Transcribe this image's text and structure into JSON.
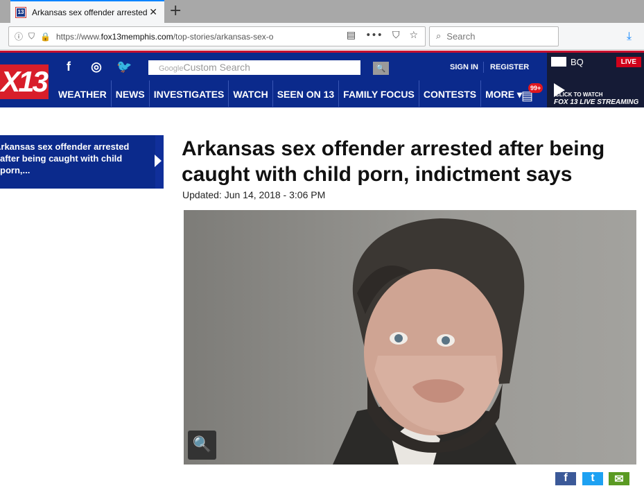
{
  "browser": {
    "tab_title": "Arkansas sex offender arrested a",
    "tab_favicon_text": "13",
    "tab_close": "✕",
    "new_tab": "+",
    "url_prefix": "https://www.",
    "url_domain": "fox13memphis.com",
    "url_path": "/top-stories/arkansas-sex-o",
    "url_info_icon": "ⓘ",
    "url_shield_icon": "⛉",
    "url_lock_icon": "🔒",
    "reader_icon": "▤",
    "more_icon": "•••",
    "pocket_icon": "⛉",
    "star_icon": "☆",
    "search_placeholder": "Search",
    "search_icon": "⌕",
    "download_icon": "⤓"
  },
  "site": {
    "logo_text": "X13",
    "social": [
      "f",
      "◎",
      "🐦"
    ],
    "search_brand": "Google",
    "search_placeholder": "Custom Search",
    "search_button": "🔍",
    "sign_in": "SIGN IN",
    "register": "REGISTER",
    "nav": [
      "WEATHER",
      "NEWS",
      "INVESTIGATES",
      "WATCH",
      "SEEN ON 13",
      "FAMILY FOCUS",
      "CONTESTS",
      "MORE ▾"
    ],
    "notification_badge": "99+",
    "live_panel": {
      "bq": "BQ",
      "live": "LIVE",
      "click_to_watch": "CLICK TO WATCH",
      "live_streaming": "FOX 13  LIVE STREAMING"
    }
  },
  "sidebar": {
    "story": "Arkansas sex offender arrested after being caught with child porn,..."
  },
  "article": {
    "headline": "Arkansas sex offender arrested after being caught with child porn, indictment says",
    "updated": "Updated: Jun 14, 2018 - 3:06 PM",
    "zoom_icon": "🔍"
  },
  "share": {
    "facebook": "f",
    "twitter": "t",
    "email": "✉"
  },
  "colors": {
    "brand_blue": "#0b2a8c",
    "brand_red": "#d81e2a",
    "firefox_accent": "#0a84ff"
  }
}
